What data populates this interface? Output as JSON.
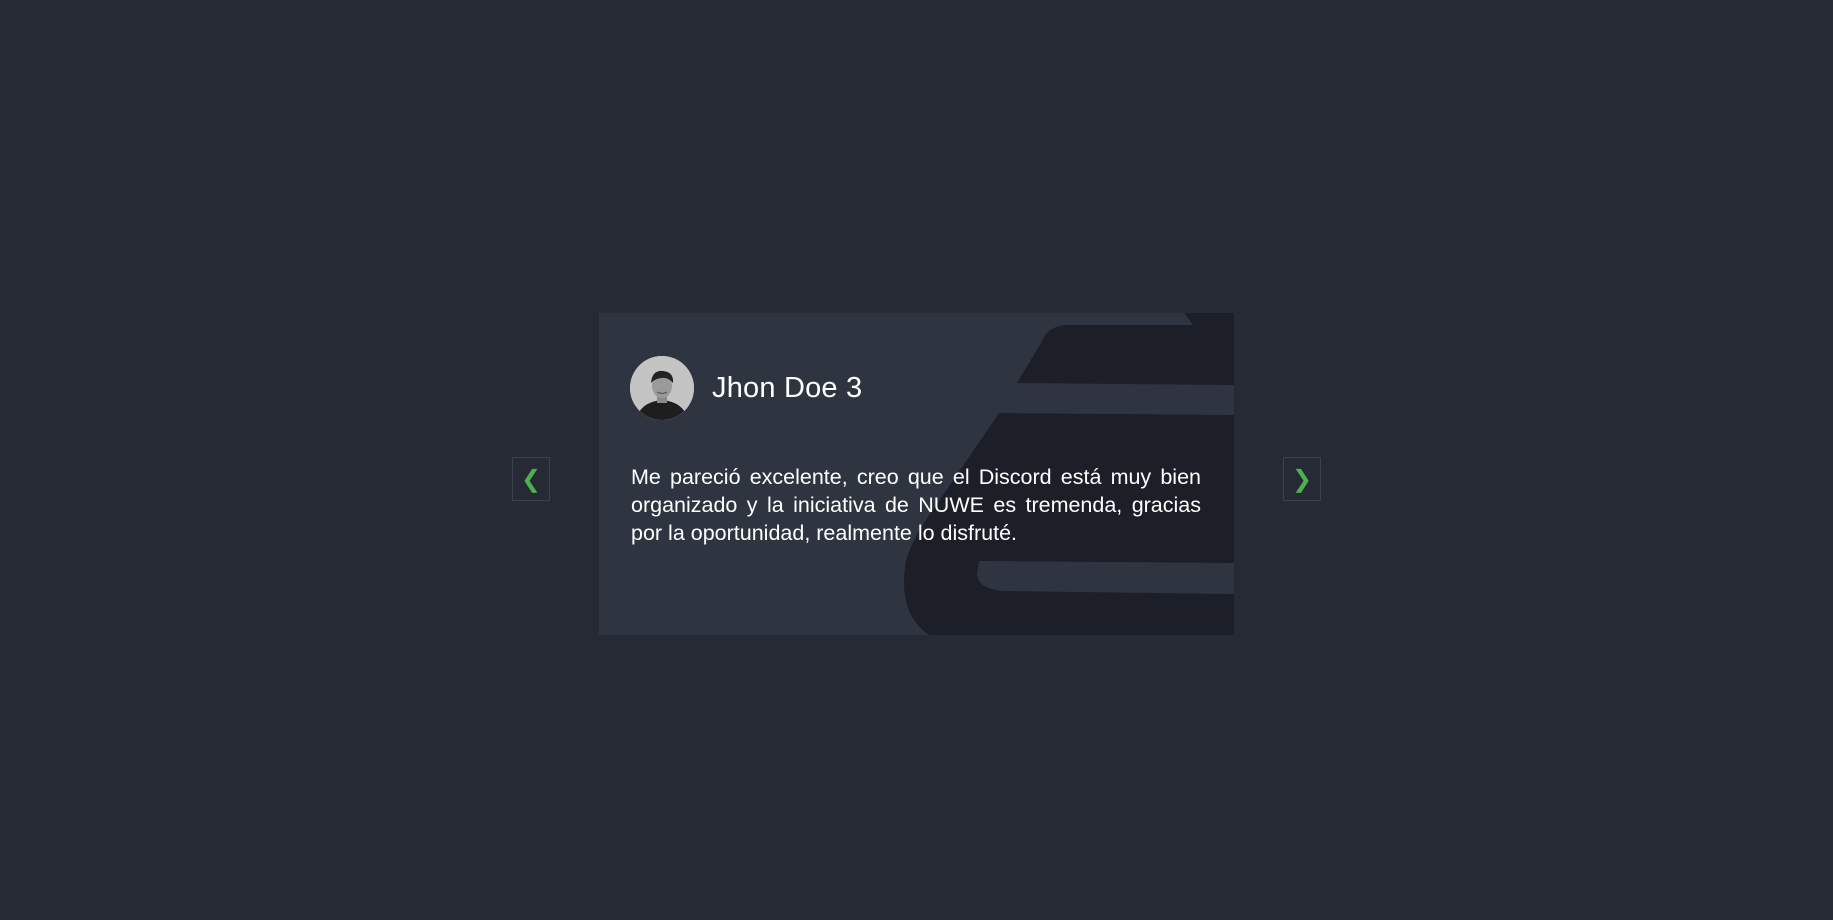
{
  "testimonial": {
    "name": "Jhon Doe 3",
    "text": "Me pareció excelente, creo que el Discord está muy bien organizado y la iniciativa de NUWE es tremenda, gracias por la oportunidad, realmente lo disfruté.",
    "avatar_icon": "person-photo"
  },
  "controls": {
    "prev_label": "❮",
    "next_label": "❯"
  },
  "colors": {
    "page_background": "#252a35",
    "card_background": "#2f3540",
    "card_shape": "#1c1e28",
    "arrow_accent": "#4caf50",
    "text": "#ffffff"
  }
}
